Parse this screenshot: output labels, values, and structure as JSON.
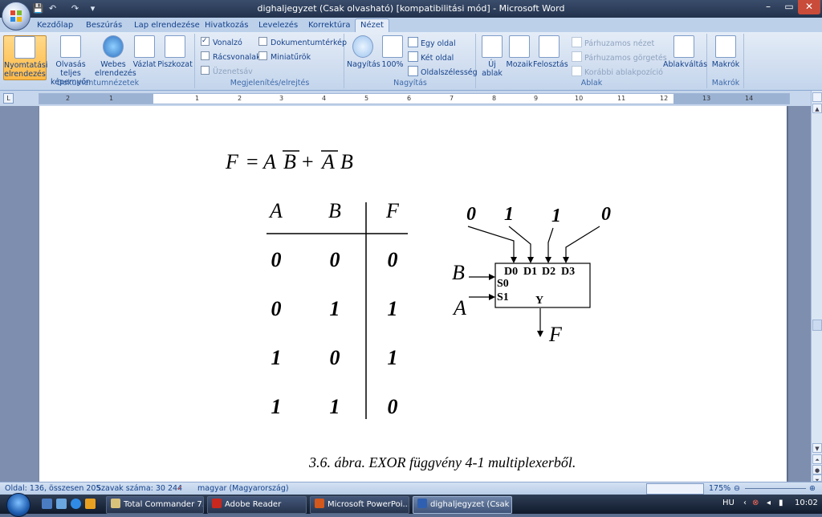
{
  "window": {
    "title": "dighaljegyzet (Csak olvasható) [kompatibilitási mód] - Microsoft Word",
    "controls": [
      "–",
      "▭",
      "✕"
    ]
  },
  "qat": {
    "save": "💾",
    "undo": "↶",
    "redo": "↷",
    "more": "▾"
  },
  "tabs": [
    "Kezdőlap",
    "Beszúrás",
    "Lap elrendezése",
    "Hivatkozás",
    "Levelezés",
    "Korrektúra",
    "Nézet"
  ],
  "ribbon": {
    "groups": {
      "views": {
        "label": "Dokumentumnézetek",
        "buttons": [
          {
            "label": "Nyomtatási elrendezés",
            "active": true
          },
          {
            "label": "Olvasás teljes képernyőn"
          },
          {
            "label": "Webes elrendezés"
          },
          {
            "label": "Vázlat"
          },
          {
            "label": "Piszkozat"
          }
        ]
      },
      "show": {
        "label": "Megjelenítés/elrejtés",
        "items": [
          {
            "label": "Vonalzó",
            "checked": true
          },
          {
            "label": "Rácsvonalak",
            "checked": false
          },
          {
            "label": "Üzenetsáv",
            "checked": false,
            "disabled": true
          },
          {
            "label": "Dokumentumtérkép",
            "checked": false
          },
          {
            "label": "Miniatűrök",
            "checked": false
          }
        ]
      },
      "zoom": {
        "label": "Nagyítás",
        "zoom_btn": "Nagyítás",
        "hundred_btn": "100%",
        "one_page": "Egy oldal",
        "two_pages": "Két oldal",
        "page_width": "Oldalszélesség"
      },
      "window": {
        "label": "Ablak",
        "new_window": "Új ablak",
        "arrange": "Mozaik",
        "split": "Felosztás",
        "side_by_side": "Párhuzamos nézet",
        "sync_scroll": "Párhuzamos görgetés",
        "reset_pos": "Korábbi ablakpozíció",
        "switch": "Ablakváltás"
      },
      "macros": {
        "label": "Makrók",
        "button": "Makrók"
      }
    }
  },
  "ruler": {
    "corner": "L",
    "ticks": [
      "2",
      "1",
      "1",
      "2",
      "3",
      "4",
      "5",
      "6",
      "7",
      "8",
      "9",
      "10",
      "11",
      "12",
      "13",
      "14"
    ]
  },
  "document": {
    "equation": {
      "F": "F",
      "eq": "=",
      "A1": "A",
      "B1": "B",
      "plus": "+",
      "A2": "A",
      "B2": "B"
    },
    "truth_table": {
      "headers": [
        "A",
        "B",
        "F"
      ],
      "rows": [
        [
          "0",
          "0",
          "0"
        ],
        [
          "0",
          "1",
          "1"
        ],
        [
          "1",
          "0",
          "1"
        ],
        [
          "1",
          "1",
          "0"
        ]
      ]
    },
    "mux": {
      "inputs": [
        "0",
        "1",
        "1",
        "0"
      ],
      "data_pins": [
        "D0",
        "D1",
        "D2",
        "D3"
      ],
      "select_pins": [
        "S0",
        "S1"
      ],
      "select_labels": [
        "B",
        "A"
      ],
      "output_pin": "Y",
      "output_label": "F"
    },
    "caption": "3.6. ábra. EXOR függvény 4-1 multiplexerből."
  },
  "statusbar": {
    "page": "Oldal: 136, összesen 205",
    "words": "Szavak száma: 30 244",
    "language": "magyar (Magyarország)",
    "zoom": "175%"
  },
  "taskbar": {
    "tasks": [
      {
        "label": "Total Commander 7....",
        "color": "#d9c27a"
      },
      {
        "label": "Adobe Reader",
        "color": "#c8281e"
      },
      {
        "label": "Microsoft PowerPoi...",
        "color": "#d2581c"
      },
      {
        "label": "dighaljegyzet (Csak ...",
        "color": "#2f5fb0",
        "active": true
      }
    ],
    "lang": "HU",
    "time": "10:02"
  }
}
